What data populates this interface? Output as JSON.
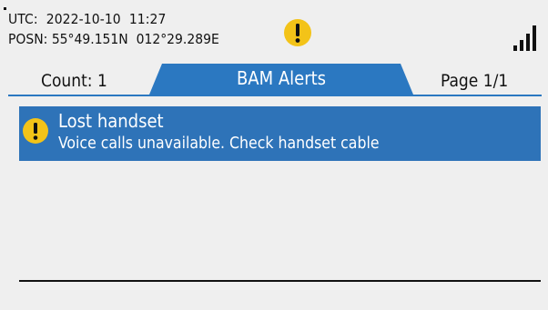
{
  "status": {
    "utc_label": "UTC:",
    "utc_value": "2022-10-10  11:27",
    "posn_label": "POSN:",
    "posn_value": "55°49.151N  012°29.289E",
    "warning_icon": "warning-icon",
    "signal_icon": "signal-strength-icon"
  },
  "tabs": {
    "count_label": "Count: 1",
    "title": "BAM Alerts",
    "page_label": "Page 1/1"
  },
  "alerts": [
    {
      "icon": "warning-icon",
      "title": "Lost handset",
      "message": "Voice calls unavailable. Check handset cable"
    }
  ],
  "colors": {
    "accent_blue": "#2e73b8",
    "warning_yellow": "#f3c318",
    "background": "#efefef"
  }
}
